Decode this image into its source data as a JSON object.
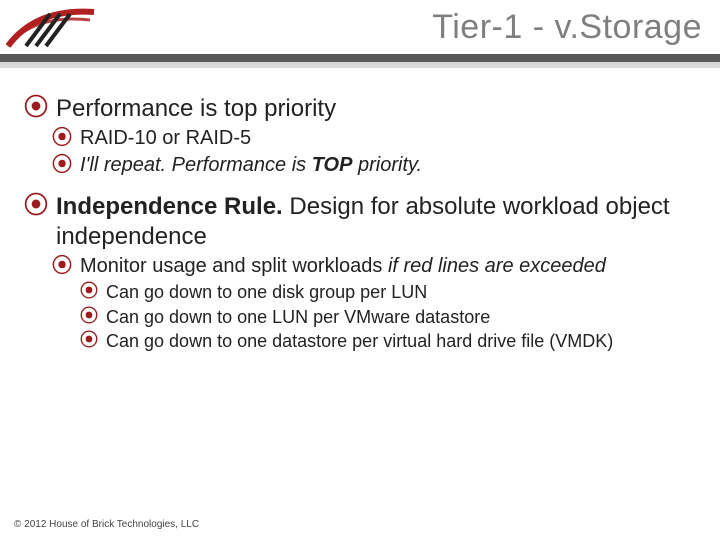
{
  "header": {
    "title": "Tier-1 - v.Storage"
  },
  "content": {
    "b1a": "Performance is top priority",
    "b2a": "RAID-10 or RAID-5",
    "b2b_pre": "I'll repeat. Performance is ",
    "b2b_bold": "TOP",
    "b2b_post": " priority.",
    "b1b_bold": "Independence Rule.",
    "b1b_rest": " Design for absolute workload object independence",
    "b2c_pre": "Monitor usage and split workloads ",
    "b2c_em": "if red lines are exceeded",
    "b3a": "Can go down to one disk group per LUN",
    "b3b": "Can go down to one LUN per VMware datastore",
    "b3c": "Can go down to one datastore per virtual hard drive file (VMDK)"
  },
  "footer": {
    "copyright": "© 2012 House of Brick Technologies, LLC"
  },
  "glyphs": {
    "bullet": "⦿"
  }
}
